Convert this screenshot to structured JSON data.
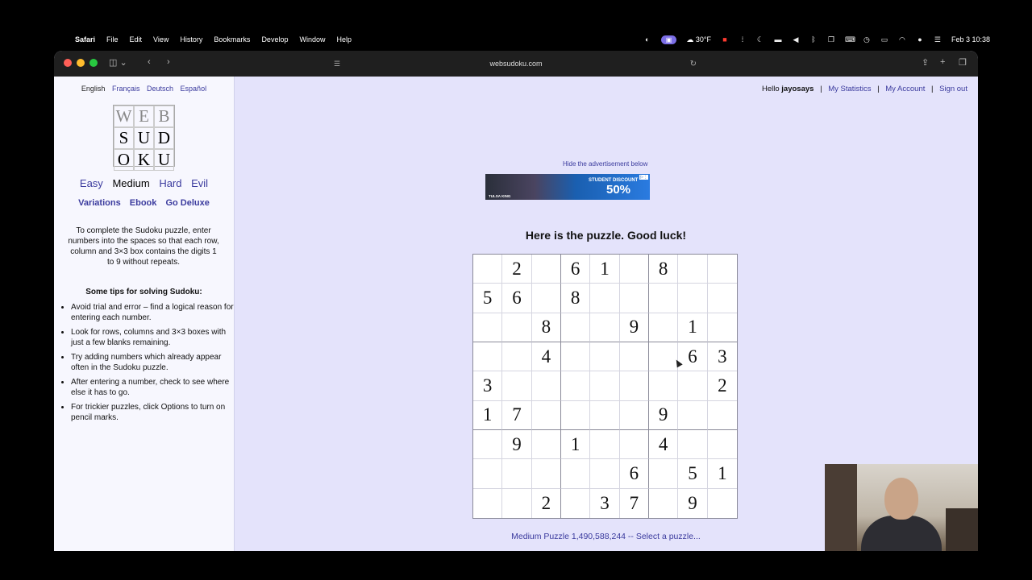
{
  "menubar": {
    "app": "Safari",
    "items": [
      "File",
      "Edit",
      "View",
      "History",
      "Bookmarks",
      "Develop",
      "Window",
      "Help"
    ],
    "weather": "30°F",
    "datetime": "Feb 3  10:38"
  },
  "browser": {
    "url": "websudoku.com"
  },
  "sidebar": {
    "languages": [
      "English",
      "Français",
      "Deutsch",
      "Español"
    ],
    "logo_letters": [
      "W",
      "E",
      "B",
      "S",
      "U",
      "D",
      "O",
      "K",
      "U"
    ],
    "levels": [
      "Easy",
      "Medium",
      "Hard",
      "Evil"
    ],
    "extras": [
      "Variations",
      "Ebook",
      "Go Deluxe"
    ],
    "intro": "To complete the Sudoku puzzle, enter numbers into the spaces so that each row, column and 3×3 box contains the digits 1 to 9 without repeats.",
    "tips_heading": "Some tips for solving Sudoku:",
    "tips": [
      "Avoid trial and error – find a logical reason for entering each number.",
      "Look for rows, columns and 3×3 boxes with just a few blanks remaining.",
      "Try adding numbers which already appear often in the Sudoku puzzle.",
      "After entering a number, check to see where else it has to go.",
      "For trickier puzzles, click Options to turn on pencil marks."
    ]
  },
  "account": {
    "greeting": "Hello",
    "user": "jayosays",
    "links": [
      "My Statistics",
      "My Account",
      "Sign out"
    ]
  },
  "ad": {
    "hide_text": "Hide the advertisement below",
    "brand": "TULSA KING",
    "tagline": "STUDENT DISCOUNT",
    "offer": "50%"
  },
  "puzzle": {
    "heading": "Here is the puzzle. Good luck!",
    "grid": [
      [
        "",
        "2",
        "",
        "6",
        "1",
        "",
        "8",
        "",
        ""
      ],
      [
        "5",
        "6",
        "",
        "8",
        "",
        "",
        "",
        "",
        ""
      ],
      [
        "",
        "",
        "8",
        "",
        "",
        "9",
        "",
        "1",
        ""
      ],
      [
        "",
        "",
        "4",
        "",
        "",
        "",
        "",
        "6",
        "3"
      ],
      [
        "3",
        "",
        "",
        "",
        "",
        "",
        "",
        "",
        "2"
      ],
      [
        "1",
        "7",
        "",
        "",
        "",
        "",
        "9",
        "",
        ""
      ],
      [
        "",
        "9",
        "",
        "1",
        "",
        "",
        "4",
        "",
        ""
      ],
      [
        "",
        "",
        "",
        "",
        "",
        "6",
        "",
        "5",
        "1"
      ],
      [
        "",
        "",
        "2",
        "",
        "3",
        "7",
        "",
        "9",
        ""
      ]
    ],
    "footer": "Medium Puzzle 1,490,588,244 -- Select a puzzle..."
  }
}
